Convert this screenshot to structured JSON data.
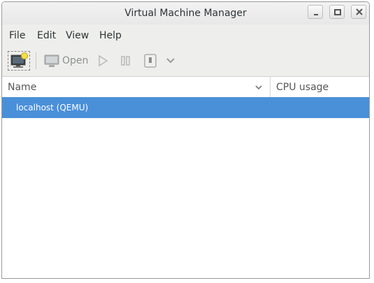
{
  "window": {
    "title": "Virtual Machine Manager"
  },
  "menu": {
    "items": [
      "File",
      "Edit",
      "View",
      "Help"
    ]
  },
  "toolbar": {
    "new_vm_icon": "new-vm-icon",
    "open_label": "Open",
    "run_icon": "play-icon",
    "pause_icon": "pause-icon",
    "shutdown_icon": "shutdown-icon"
  },
  "table": {
    "columns": [
      "Name",
      "CPU usage"
    ],
    "rows": [
      {
        "name": "localhost (QEMU)",
        "selected": true
      }
    ]
  },
  "colors": {
    "selection": "#4a90d9",
    "toolbar_bg": "#eeeeec"
  }
}
